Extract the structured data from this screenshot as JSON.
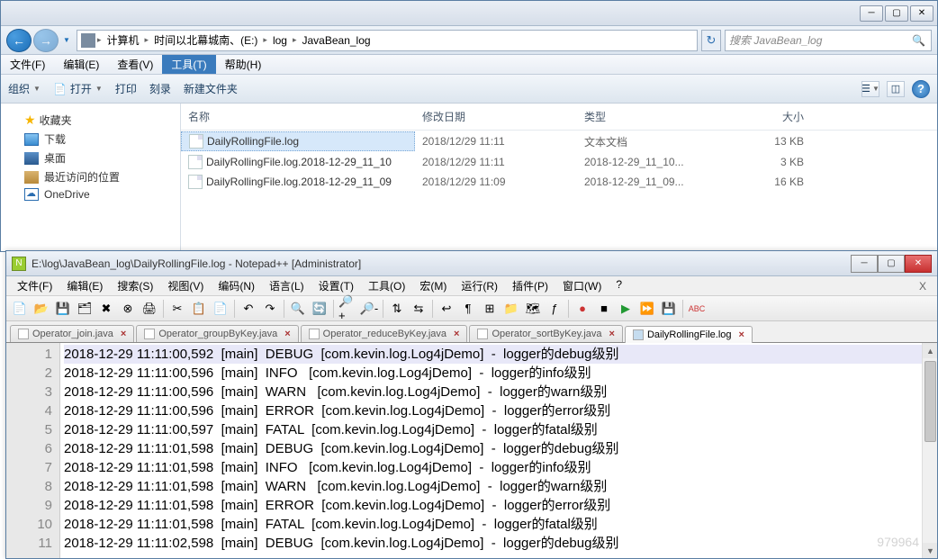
{
  "explorer": {
    "breadcrumb": [
      "计算机",
      "时间以北幕城南、(E:)",
      "log",
      "JavaBean_log"
    ],
    "search_placeholder": "搜索 JavaBean_log",
    "menu": [
      "文件(F)",
      "编辑(E)",
      "查看(V)",
      "工具(T)",
      "帮助(H)"
    ],
    "menu_active_index": 3,
    "toolbar": {
      "organize": "组织",
      "open": "打开",
      "print": "打印",
      "burn": "刻录",
      "newfolder": "新建文件夹"
    },
    "side": {
      "fav": "收藏夹",
      "downloads": "下载",
      "desktop": "桌面",
      "recent": "最近访问的位置",
      "onedrive": "OneDrive"
    },
    "columns": {
      "name": "名称",
      "date": "修改日期",
      "type": "类型",
      "size": "大小"
    },
    "files": [
      {
        "name": "DailyRollingFile.log",
        "date": "2018/12/29 11:11",
        "type": "文本文档",
        "size": "13 KB",
        "selected": true
      },
      {
        "name": "DailyRollingFile.log.2018-12-29_11_10",
        "date": "2018/12/29 11:11",
        "type": "2018-12-29_11_10...",
        "size": "3 KB",
        "selected": false
      },
      {
        "name": "DailyRollingFile.log.2018-12-29_11_09",
        "date": "2018/12/29 11:09",
        "type": "2018-12-29_11_09...",
        "size": "16 KB",
        "selected": false
      }
    ]
  },
  "npp": {
    "title": "E:\\log\\JavaBean_log\\DailyRollingFile.log - Notepad++ [Administrator]",
    "menu": [
      "文件(F)",
      "编辑(E)",
      "搜索(S)",
      "视图(V)",
      "编码(N)",
      "语言(L)",
      "设置(T)",
      "工具(O)",
      "宏(M)",
      "运行(R)",
      "插件(P)",
      "窗口(W)",
      "?"
    ],
    "tabs": [
      {
        "label": "Operator_join.java",
        "active": false
      },
      {
        "label": "Operator_groupByKey.java",
        "active": false
      },
      {
        "label": "Operator_reduceByKey.java",
        "active": false
      },
      {
        "label": "Operator_sortByKey.java",
        "active": false
      },
      {
        "label": "DailyRollingFile.log",
        "active": true
      }
    ],
    "lines": [
      "2018-12-29 11:11:00,592  [main]  DEBUG  [com.kevin.log.Log4jDemo]  -  logger的debug级别",
      "2018-12-29 11:11:00,596  [main]  INFO   [com.kevin.log.Log4jDemo]  -  logger的info级别",
      "2018-12-29 11:11:00,596  [main]  WARN   [com.kevin.log.Log4jDemo]  -  logger的warn级别",
      "2018-12-29 11:11:00,596  [main]  ERROR  [com.kevin.log.Log4jDemo]  -  logger的error级别",
      "2018-12-29 11:11:00,597  [main]  FATAL  [com.kevin.log.Log4jDemo]  -  logger的fatal级别",
      "2018-12-29 11:11:01,598  [main]  DEBUG  [com.kevin.log.Log4jDemo]  -  logger的debug级别",
      "2018-12-29 11:11:01,598  [main]  INFO   [com.kevin.log.Log4jDemo]  -  logger的info级别",
      "2018-12-29 11:11:01,598  [main]  WARN   [com.kevin.log.Log4jDemo]  -  logger的warn级别",
      "2018-12-29 11:11:01,598  [main]  ERROR  [com.kevin.log.Log4jDemo]  -  logger的error级别",
      "2018-12-29 11:11:01,598  [main]  FATAL  [com.kevin.log.Log4jDemo]  -  logger的fatal级别",
      "2018-12-29 11:11:02,598  [main]  DEBUG  [com.kevin.log.Log4jDemo]  -  logger的debug级别"
    ],
    "watermark": "979964"
  }
}
